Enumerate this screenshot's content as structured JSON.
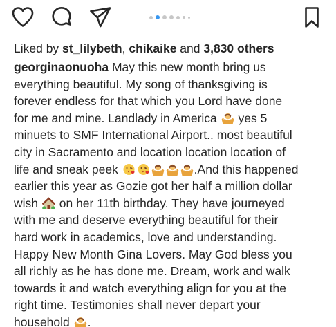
{
  "actions": {
    "like_icon": "heart-outline",
    "comment_icon": "speech-bubble",
    "share_icon": "paper-plane",
    "save_icon": "bookmark"
  },
  "carousel": {
    "dot_count": 7,
    "active_index": 1
  },
  "likes": {
    "prefix": "Liked by ",
    "user1": "st_lilybeth",
    "separator": ", ",
    "user2": "chikaike",
    "connector": " and ",
    "others": "3,830 others"
  },
  "caption": {
    "username": "georginaonuoha",
    "lines": [
      " May this new month bring us",
      "everything beautiful. My song of thanksgiving is",
      "forever endless for that which  you Lord have done",
      "for me and mine. Landlady in America",
      " yes 5",
      "minuets to SMF International Airport.. most beautiful",
      "city in Sacramento and location location location of",
      "life and sneak peek ",
      ".And this happened",
      "earlier this year as Gozie got her half a million dollar",
      "wish ",
      " on her 11th birthday. They have journeyed",
      "with me and deserve everything beautiful for their",
      "hard work in academics, love and understanding.",
      "Happy New Month Gina Lovers. May God bless you",
      "all richly as he has done me. Dream, work and walk",
      "towards it and watch everything align for you at the",
      "right time. Testimonies shall never depart your",
      "household ",
      "."
    ]
  },
  "colors": {
    "text": "#262626",
    "active_dot": "#3897f0",
    "inactive_dot": "#c7c7c7"
  }
}
